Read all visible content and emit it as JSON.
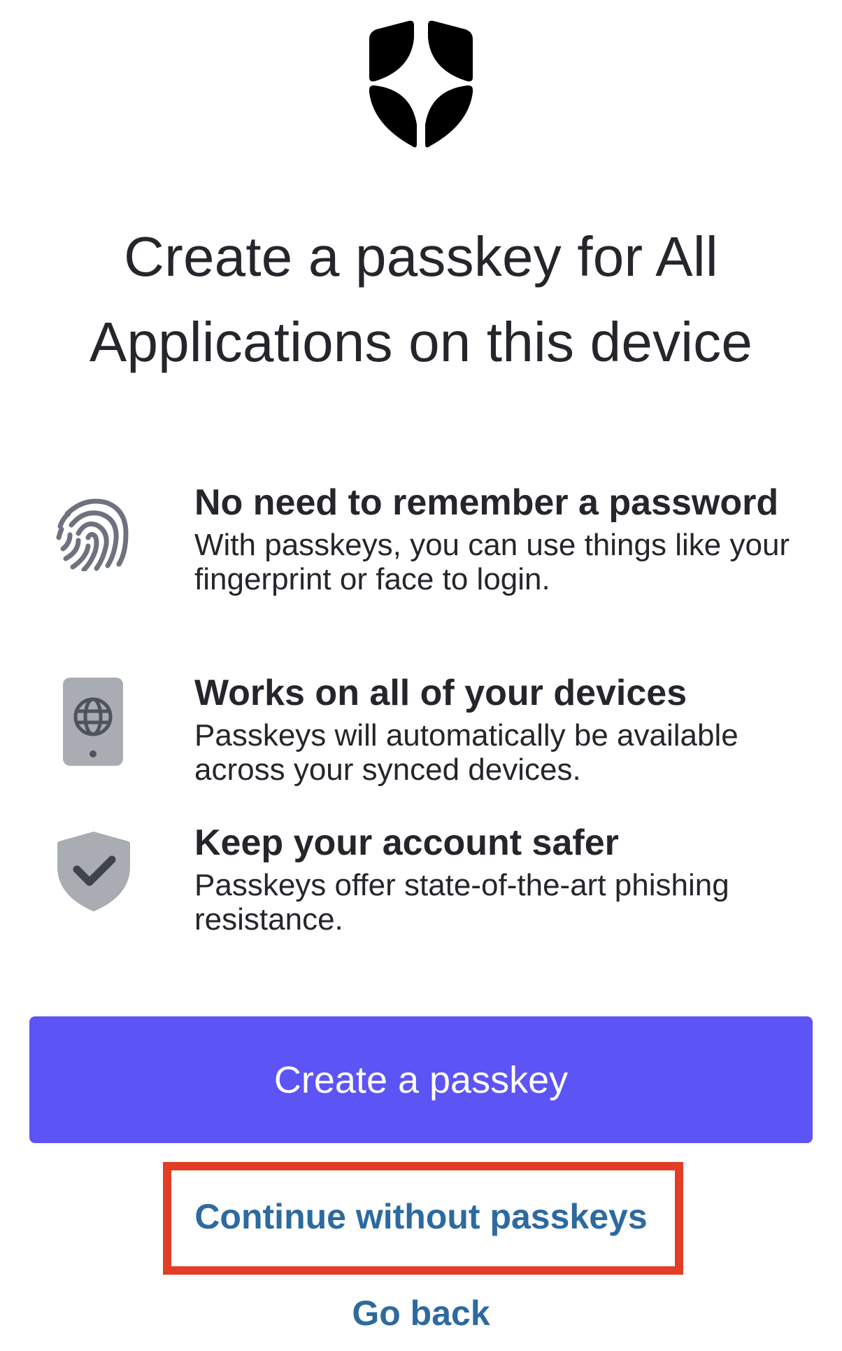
{
  "logo": {
    "icon": "shield-logo-icon",
    "color": "#000000"
  },
  "title": {
    "line1": "Create a passkey for All",
    "line2": "Applications on this device"
  },
  "features": [
    {
      "icon": "fingerprint-icon",
      "heading": "No need to remember a password",
      "description": "With passkeys, you can use things like your fingerprint or face to login."
    },
    {
      "icon": "device-globe-icon",
      "heading": "Works on all of your devices",
      "description": "Passkeys will automatically be available across your synced devices."
    },
    {
      "icon": "shield-check-icon",
      "heading": "Keep your account safer",
      "description": "Passkeys offer state-of-the-art phishing resistance."
    }
  ],
  "actions": {
    "primary_label": "Create a passkey",
    "continue_label": "Continue without passkeys",
    "back_label": "Go back"
  },
  "colors": {
    "primary": "#5C54F4",
    "link": "#2C6AA0",
    "highlight": "#E23D26",
    "icon_gray": "#6E7280"
  }
}
